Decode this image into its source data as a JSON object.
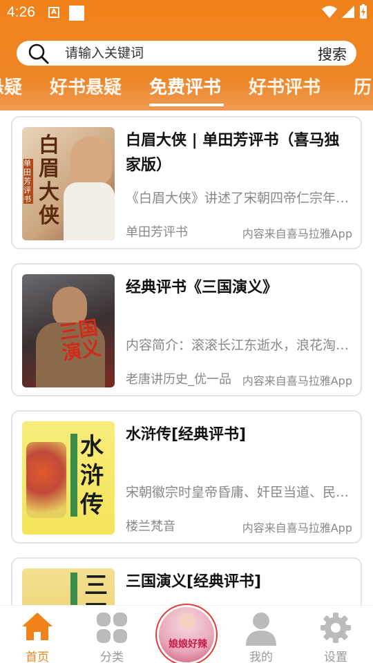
{
  "status": {
    "time": "4:26",
    "a_icon": "A"
  },
  "search": {
    "placeholder": "请输入关键词",
    "button": "搜索"
  },
  "tabs": [
    {
      "label": "悬疑"
    },
    {
      "label": "好书悬疑"
    },
    {
      "label": "免费评书"
    },
    {
      "label": "好书评书"
    },
    {
      "label": "历"
    }
  ],
  "books": [
    {
      "title": "白眉大侠 | 单田芳评书（喜马独家版）",
      "desc": "《白眉大侠》讲述了宋朝四帝仁宗年间的故事",
      "author": "单田芳评书",
      "source": "内容来自喜马拉雅App",
      "cover_text": "白眉大侠",
      "cover_sub": "单田芳评书"
    },
    {
      "title": "经典评书《三国演义》",
      "desc": "内容简介：滚滚长江东逝水，浪花淘尽英雄",
      "author": "老唐讲历史_优一品",
      "source": "内容来自喜马拉雅App",
      "cover_text": "三国演义"
    },
    {
      "title": "水浒传[经典评书]",
      "desc": "宋朝徽宗时皇帝昏庸、奸臣当道、民不聊生",
      "author": "楼兰梵音",
      "source": "内容来自喜马拉雅App",
      "cover_text": "水浒传"
    },
    {
      "title": "三国演义[经典评书]",
      "desc": "",
      "author": "",
      "source": "",
      "cover_text": "三国"
    }
  ],
  "nav": {
    "home": "首页",
    "category": "分类",
    "center_art": "娘娘好辣",
    "mine": "我的",
    "settings": "设置"
  },
  "colors": {
    "accent": "#f0821a",
    "inactive": "#999999"
  }
}
